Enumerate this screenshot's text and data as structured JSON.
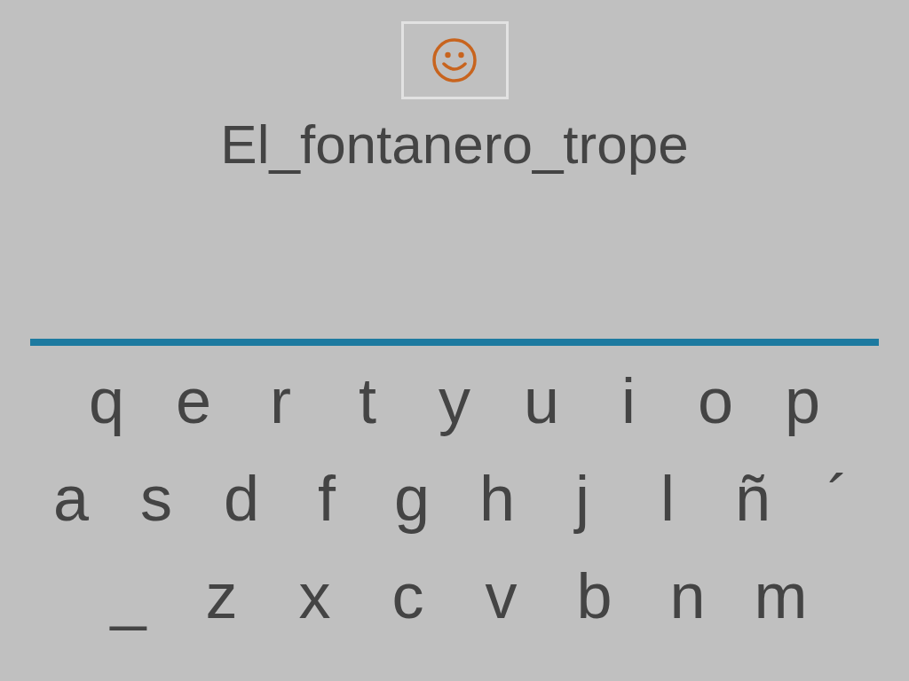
{
  "title": "El_fontanero_trope",
  "keyboard": {
    "rows": [
      [
        "q",
        "e",
        "r",
        "t",
        "y",
        "u",
        "i",
        "o",
        "p"
      ],
      [
        "a",
        "s",
        "d",
        "f",
        "g",
        "h",
        "j",
        "l",
        "ñ",
        "´"
      ],
      [
        "_",
        "z",
        "x",
        "c",
        "v",
        "b",
        "n",
        "m"
      ]
    ]
  }
}
